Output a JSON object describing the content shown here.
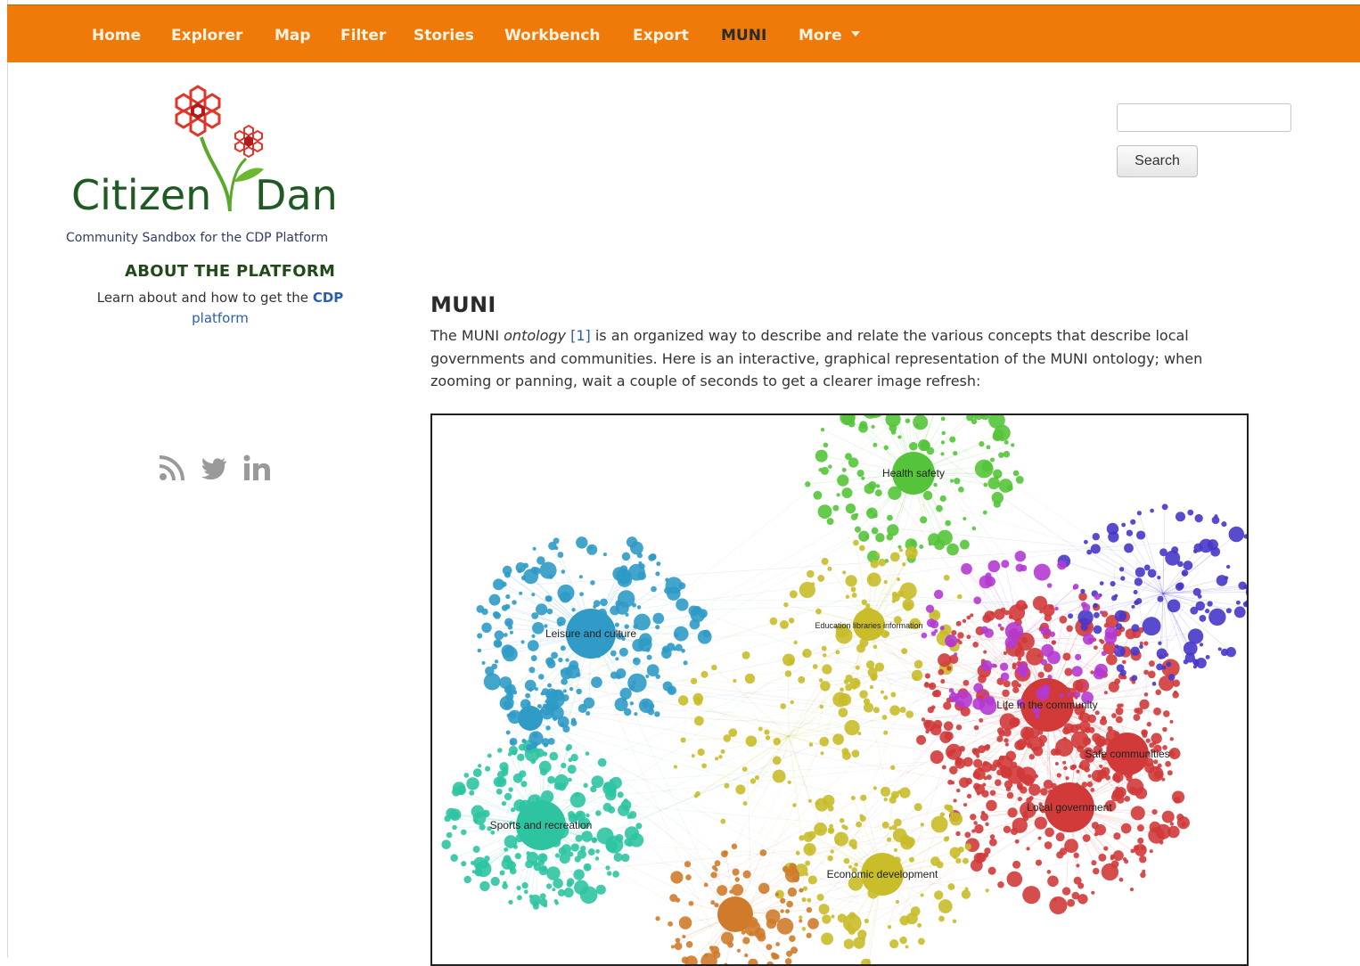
{
  "nav": {
    "items": [
      {
        "label": "Home",
        "active": false
      },
      {
        "label": "Explorer",
        "active": false
      },
      {
        "label": "Map",
        "active": false
      },
      {
        "label": "Filter",
        "active": false
      },
      {
        "label": "Stories",
        "active": false
      },
      {
        "label": "Workbench",
        "active": false
      },
      {
        "label": "Export",
        "active": false
      },
      {
        "label": "MUNI",
        "active": true
      },
      {
        "label": "More",
        "active": false
      }
    ],
    "background": "#ef7a0a",
    "text_color": "#fff3e3",
    "active_color": "#2b2b2b"
  },
  "logo": {
    "wordmark_left": "Citizen",
    "wordmark_right": "Dan"
  },
  "sidebar": {
    "tagline": "Community Sandbox for the CDP Platform",
    "about_title": "ABOUT THE PLATFORM",
    "about_text": "Learn about and how to get the",
    "about_link_bold": "CDP",
    "about_link": "platform",
    "social_icons": [
      "rss-icon",
      "twitter-icon",
      "linkedin-icon"
    ]
  },
  "search": {
    "value": "",
    "button_label": "Search"
  },
  "main": {
    "title": "MUNI",
    "intro_part1": "The MUNI",
    "intro_italic": "ontology",
    "intro_ref": "[1]",
    "intro_part2": "is an organized way to describe and relate the various concepts that describe local governments and communities. Here is an interactive, graphical representation of the MUNI ontology; when zooming or panning, wait a couple of seconds to get a clearer image refresh:"
  },
  "graph": {
    "hub_labels": [
      "Health safety",
      "Leisure and culture",
      "Education libraries information",
      "Life in the community",
      "Safe communities",
      "Local government",
      "Sports and recreation",
      "Economic development"
    ],
    "colors": {
      "green": "#55c43a",
      "blue": "#2f9bc6",
      "teal": "#2ec4a2",
      "red": "#d23a3a",
      "olive": "#c9bd2a",
      "purple": "#b43ad2",
      "navy": "#4637c9",
      "orange": "#cf7b2b"
    }
  }
}
